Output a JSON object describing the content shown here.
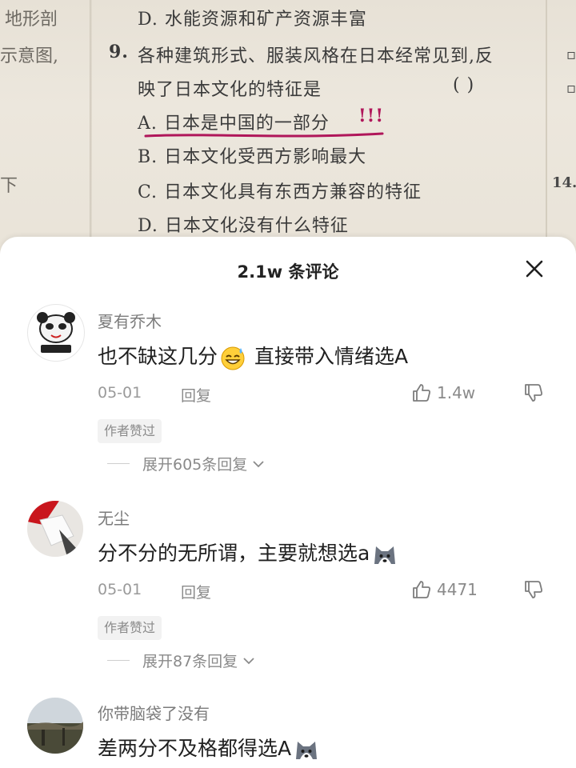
{
  "textbook": {
    "left_col": [
      "地形剖",
      "示意图,",
      "下"
    ],
    "line_option_d_prev": "D. 水能资源和矿产资源丰富",
    "q_number": "9.",
    "q_line1": "各种建筑形式、服装风格在日本经常见到,反",
    "q_line2": "映了日本文化的特征是",
    "q_paren": "(    )",
    "option_a": "A. 日本是中国的一部分",
    "option_a_marks": "!!!",
    "option_b": "B. 日本文化受西方影响最大",
    "option_c": "C. 日本文化具有东西方兼容的特征",
    "option_d": "D. 日本文化没有什么特征",
    "right_col_num": "14.",
    "colors": {
      "underline": "#b0165a"
    }
  },
  "sheet": {
    "title": "2.1w 条评论",
    "close_icon": "close-icon"
  },
  "comments": [
    {
      "username": "夏有乔木",
      "text_before": "也不缺这几分",
      "emoji": "grinning-sweat-emoji",
      "text_after": " 直接带入情绪选A",
      "date": "05-01",
      "reply": "回复",
      "likes": "1.4w",
      "badge": "作者赞过",
      "expand": "展开605条回复"
    },
    {
      "username": "无尘",
      "text_before": "分不分的无所谓，主要就想选a",
      "emoji": "husky-dog-emoji",
      "text_after": "",
      "date": "05-01",
      "reply": "回复",
      "likes": "4471",
      "badge": "作者赞过",
      "expand": "展开87条回复"
    },
    {
      "username": "你带脑袋了没有",
      "text_before": "差两分不及格都得选A",
      "emoji": "husky-dog-emoji",
      "text_after": ""
    }
  ]
}
